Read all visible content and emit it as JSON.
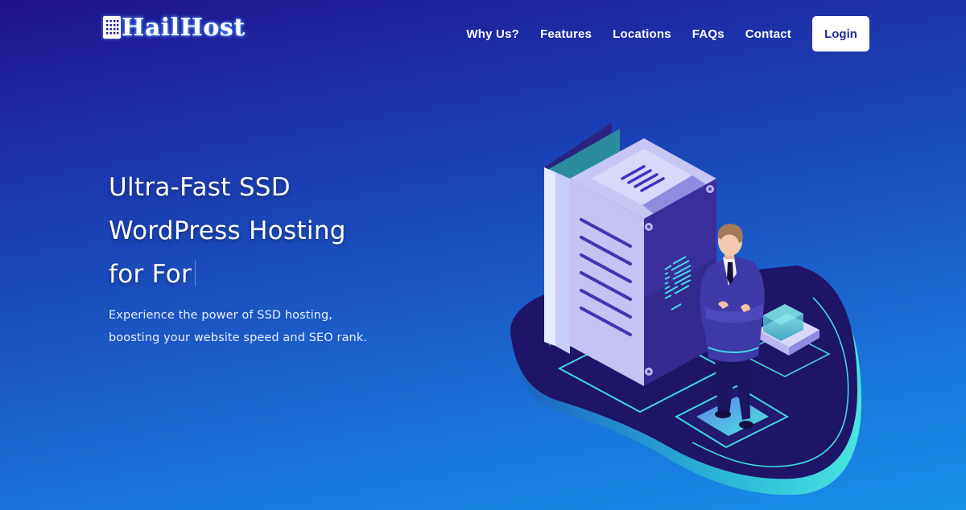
{
  "brand": {
    "name": "HailHost",
    "logo_icon": "building-grid-icon"
  },
  "nav": {
    "items": [
      {
        "label": "Why Us?"
      },
      {
        "label": "Features"
      },
      {
        "label": "Locations"
      },
      {
        "label": "FAQs"
      },
      {
        "label": "Contact"
      }
    ],
    "login_label": "Login"
  },
  "hero": {
    "title_lines": [
      "Ultra-Fast SSD",
      "WordPress Hosting",
      "for For"
    ],
    "subtitle_lines": [
      "Experience the power of SSD hosting,",
      "boosting your website speed and SEO rank."
    ]
  },
  "illustration": {
    "subject": "isometric-server-with-businessman"
  },
  "colors": {
    "bg_top": "#22118a",
    "bg_bottom": "#1592ea",
    "login_text": "#1f2e8e",
    "accent_cyan": "#3fe0e0",
    "platform": "#1e1468"
  }
}
